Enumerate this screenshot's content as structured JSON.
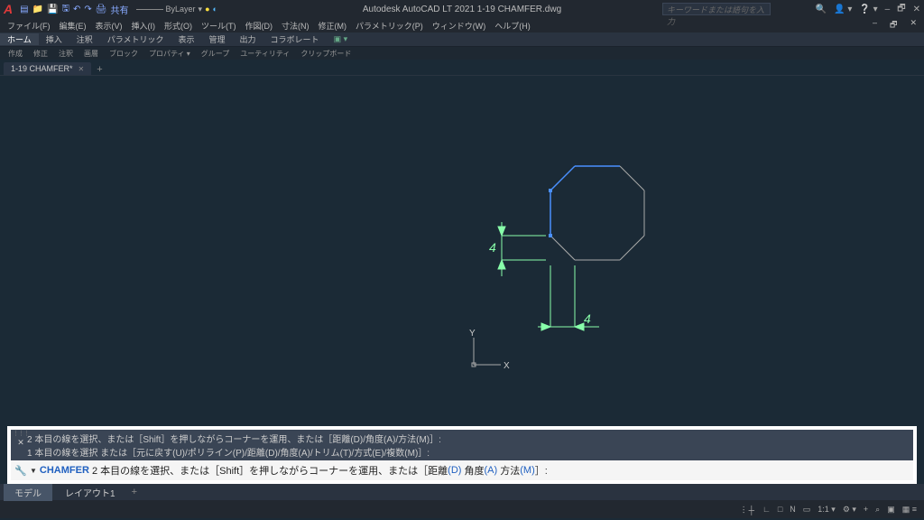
{
  "app": {
    "title": "Autodesk AutoCAD LT 2021   1-19 CHAMFER.dwg",
    "search_placeholder": "キーワードまたは語句を入力"
  },
  "qat": {
    "share": "共有"
  },
  "layer": {
    "name": "ByLayer"
  },
  "menus": [
    "ファイル(F)",
    "編集(E)",
    "表示(V)",
    "挿入(I)",
    "形式(O)",
    "ツール(T)",
    "作図(D)",
    "寸法(N)",
    "修正(M)",
    "パラメトリック(P)",
    "ウィンドウ(W)",
    "ヘルプ(H)"
  ],
  "ribbon_tabs": [
    "ホーム",
    "挿入",
    "注釈",
    "パラメトリック",
    "表示",
    "管理",
    "出力",
    "コラボレート"
  ],
  "ribbon_panels": [
    "作成",
    "修正",
    "注釈",
    "画層",
    "ブロック",
    "プロパティ ▾",
    "グループ",
    "ユーティリティ",
    "クリップボード"
  ],
  "doc_tab": {
    "name": "1-19 CHAMFER*"
  },
  "drawing": {
    "dim_v": "4",
    "dim_h": "4",
    "axis_x": "X",
    "axis_y": "Y"
  },
  "cmd_history": {
    "line1": "2 本目の線を選択、または［Shift］を押しながらコーナーを運用、または［距離(D)/角度(A)/方法(M)］:",
    "line2": "1 本目の線を選択 または［元に戻す(U)/ポリライン(P)/距離(D)/角度(A)/トリム(T)/方式(E)/複数(M)］:"
  },
  "cmd_current": {
    "command": "CHAMFER",
    "prompt_pre": "2 本目の線を選択、または［Shift］を押しながらコーナーを運用、または",
    "opt1": "距離",
    "opt1_k": "(D)",
    "opt2": "角度",
    "opt2_k": "(A)",
    "opt3": "方法",
    "opt3_k": "(M)"
  },
  "layout_tabs": {
    "model": "モデル",
    "layout1": "レイアウト1"
  },
  "status": {
    "items": [
      "︙┼",
      "∟",
      "□",
      "N",
      "▭",
      "1:1 ▾",
      "⚙ ▾",
      "+",
      "⌕",
      "▣",
      "▦ ≡"
    ]
  },
  "window_controls": {
    "minimize": "–",
    "restore": "🗗",
    "close": "✕"
  },
  "window_controls2": {
    "minimize": "–",
    "restore": "🗗",
    "close": "✕"
  }
}
